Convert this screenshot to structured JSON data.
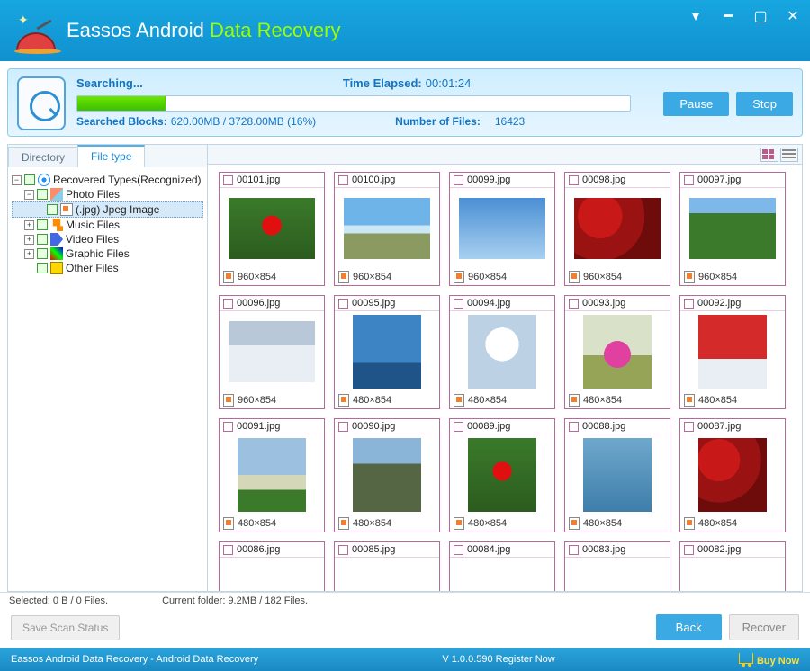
{
  "titlebar": {
    "brand_prefix": "Eassos Android ",
    "brand_accent": "Data Recovery"
  },
  "progress": {
    "status_label": "Searching...",
    "time_label": "Time Elapsed:",
    "time_value": "00:01:24",
    "percent": 16,
    "searched_label": "Searched Blocks:",
    "searched_value": "620.00MB / 3728.00MB (16%)",
    "files_label": "Number of Files:",
    "files_value": "16423",
    "pause": "Pause",
    "stop": "Stop"
  },
  "tabs": {
    "directory": "Directory",
    "filetype": "File type"
  },
  "tree": {
    "root": "Recovered Types(Recognized)",
    "photo": "Photo Files",
    "jpg": "(.jpg) Jpeg Image",
    "music": "Music Files",
    "video": "Video Files",
    "graphic": "Graphic Files",
    "other": "Other Files"
  },
  "thumbs": [
    {
      "name": "00101.jpg",
      "dim": "960×854",
      "cls": "ph-flower-red",
      "wide": true
    },
    {
      "name": "00100.jpg",
      "dim": "960×854",
      "cls": "ph-beach",
      "wide": true
    },
    {
      "name": "00099.jpg",
      "dim": "960×854",
      "cls": "ph-sky",
      "wide": true
    },
    {
      "name": "00098.jpg",
      "dim": "960×854",
      "cls": "ph-leaves-red",
      "wide": true
    },
    {
      "name": "00097.jpg",
      "dim": "960×854",
      "cls": "ph-trees-green",
      "wide": true
    },
    {
      "name": "00096.jpg",
      "dim": "960×854",
      "cls": "ph-snow",
      "wide": true
    },
    {
      "name": "00095.jpg",
      "dim": "480×854",
      "cls": "ph-palm"
    },
    {
      "name": "00094.jpg",
      "dim": "480×854",
      "cls": "ph-blossom"
    },
    {
      "name": "00093.jpg",
      "dim": "480×854",
      "cls": "ph-bike"
    },
    {
      "name": "00092.jpg",
      "dim": "480×854",
      "cls": "ph-snowballs"
    },
    {
      "name": "00091.jpg",
      "dim": "480×854",
      "cls": "ph-coast"
    },
    {
      "name": "00090.jpg",
      "dim": "480×854",
      "cls": "ph-cliffs"
    },
    {
      "name": "00089.jpg",
      "dim": "480×854",
      "cls": "ph-flower-red"
    },
    {
      "name": "00088.jpg",
      "dim": "480×854",
      "cls": "ph-water"
    },
    {
      "name": "00087.jpg",
      "dim": "480×854",
      "cls": "ph-leaves-red"
    },
    {
      "name": "00086.jpg",
      "dim": "",
      "cls": ""
    },
    {
      "name": "00085.jpg",
      "dim": "",
      "cls": ""
    },
    {
      "name": "00084.jpg",
      "dim": "",
      "cls": ""
    },
    {
      "name": "00083.jpg",
      "dim": "",
      "cls": ""
    },
    {
      "name": "00082.jpg",
      "dim": "",
      "cls": ""
    }
  ],
  "status": {
    "selected": "Selected: 0 B / 0 Files.",
    "current": "Current folder: 9.2MB / 182 Files."
  },
  "buttons": {
    "save_scan": "Save Scan Status",
    "back": "Back",
    "recover": "Recover"
  },
  "footer": {
    "left": "Eassos Android Data Recovery - Android Data Recovery",
    "version": "V 1.0.0.590  Register Now",
    "buy": "Buy Now"
  }
}
